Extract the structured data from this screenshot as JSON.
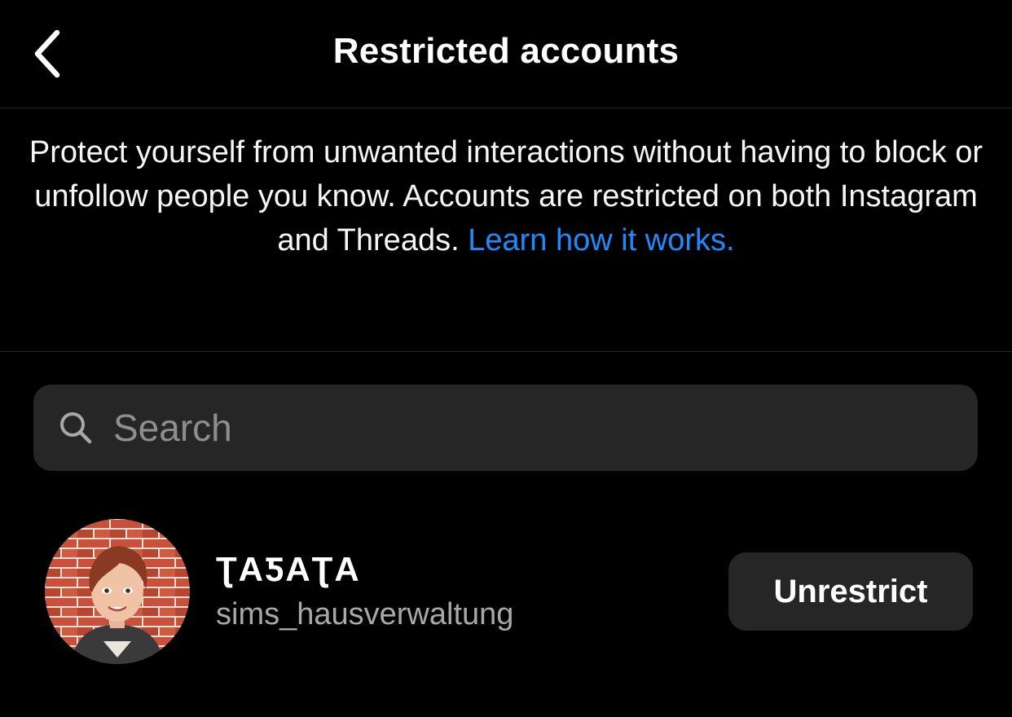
{
  "header": {
    "title": "Restricted accounts",
    "back_icon": "chevron-left-icon"
  },
  "description": {
    "text": "Protect yourself from unwanted interactions without having to block or unfollow people you know. Accounts are restricted on both Instagram and Threads. ",
    "link_text": "Learn how it works.",
    "link_color": "#1a8cff"
  },
  "search": {
    "placeholder": "Search",
    "value": "",
    "icon": "search-icon"
  },
  "accounts": [
    {
      "display_name": "ƮΑƼΑƮΑ",
      "username": "sims_hausverwaltung",
      "action_label": "Unrestrict"
    }
  ],
  "colors": {
    "background": "#000000",
    "surface": "#262626",
    "text_primary": "#ffffff",
    "text_secondary": "#a8a8a8",
    "accent": "#1a8cff"
  }
}
